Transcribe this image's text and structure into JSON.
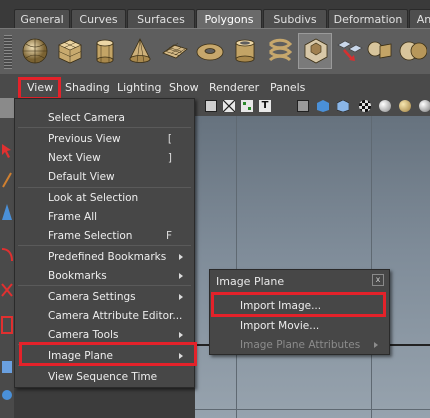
{
  "shelf": {
    "tabs": [
      {
        "label": "General",
        "active": false
      },
      {
        "label": "Curves",
        "active": false
      },
      {
        "label": "Surfaces",
        "active": false
      },
      {
        "label": "Polygons",
        "active": true
      },
      {
        "label": "Subdivs",
        "active": false
      },
      {
        "label": "Deformation",
        "active": false
      },
      {
        "label": "An",
        "active": false
      }
    ],
    "icons": [
      "poly-sphere-icon",
      "poly-cube-icon",
      "poly-cylinder-icon",
      "poly-cone-icon",
      "poly-plane-icon",
      "poly-torus-icon",
      "poly-pipe-icon",
      "combine-icon",
      "separate-icon",
      "extract-icon",
      "smooth-icon",
      "append-icon"
    ]
  },
  "panel_menu": {
    "items": [
      "View",
      "Shading",
      "Lighting",
      "Show",
      "Renderer",
      "Panels"
    ]
  },
  "view_menu": {
    "items": [
      {
        "label": "Select Camera",
        "shortcut": "",
        "submenu": false
      },
      {
        "label": "Previous View",
        "shortcut": "[",
        "submenu": false
      },
      {
        "label": "Next View",
        "shortcut": "]",
        "submenu": false
      },
      {
        "label": "Default View",
        "shortcut": "",
        "submenu": false
      },
      {
        "label": "Look at Selection",
        "shortcut": "",
        "submenu": false
      },
      {
        "label": "Frame All",
        "shortcut": "",
        "submenu": false
      },
      {
        "label": "Frame Selection",
        "shortcut": "F",
        "submenu": false
      },
      {
        "label": "Predefined Bookmarks",
        "shortcut": "",
        "submenu": true
      },
      {
        "label": "Bookmarks",
        "shortcut": "",
        "submenu": true
      },
      {
        "label": "Camera Settings",
        "shortcut": "",
        "submenu": true
      },
      {
        "label": "Camera Attribute Editor...",
        "shortcut": "",
        "submenu": false
      },
      {
        "label": "Camera Tools",
        "shortcut": "",
        "submenu": true
      },
      {
        "label": "Image Plane",
        "shortcut": "",
        "submenu": true
      },
      {
        "label": "View Sequence Time",
        "shortcut": "",
        "submenu": false
      }
    ]
  },
  "image_plane_menu": {
    "title": "Image Plane",
    "close_label": "x",
    "items": [
      {
        "label": "Import Image...",
        "enabled": true
      },
      {
        "label": "Import Movie...",
        "enabled": true
      },
      {
        "label": "Image Plane Attributes",
        "enabled": false
      }
    ]
  },
  "colors": {
    "highlight": "#e4222a",
    "menu_bg": "#474747",
    "viewport_top": "#66727e",
    "viewport_bottom": "#97a3ae"
  }
}
